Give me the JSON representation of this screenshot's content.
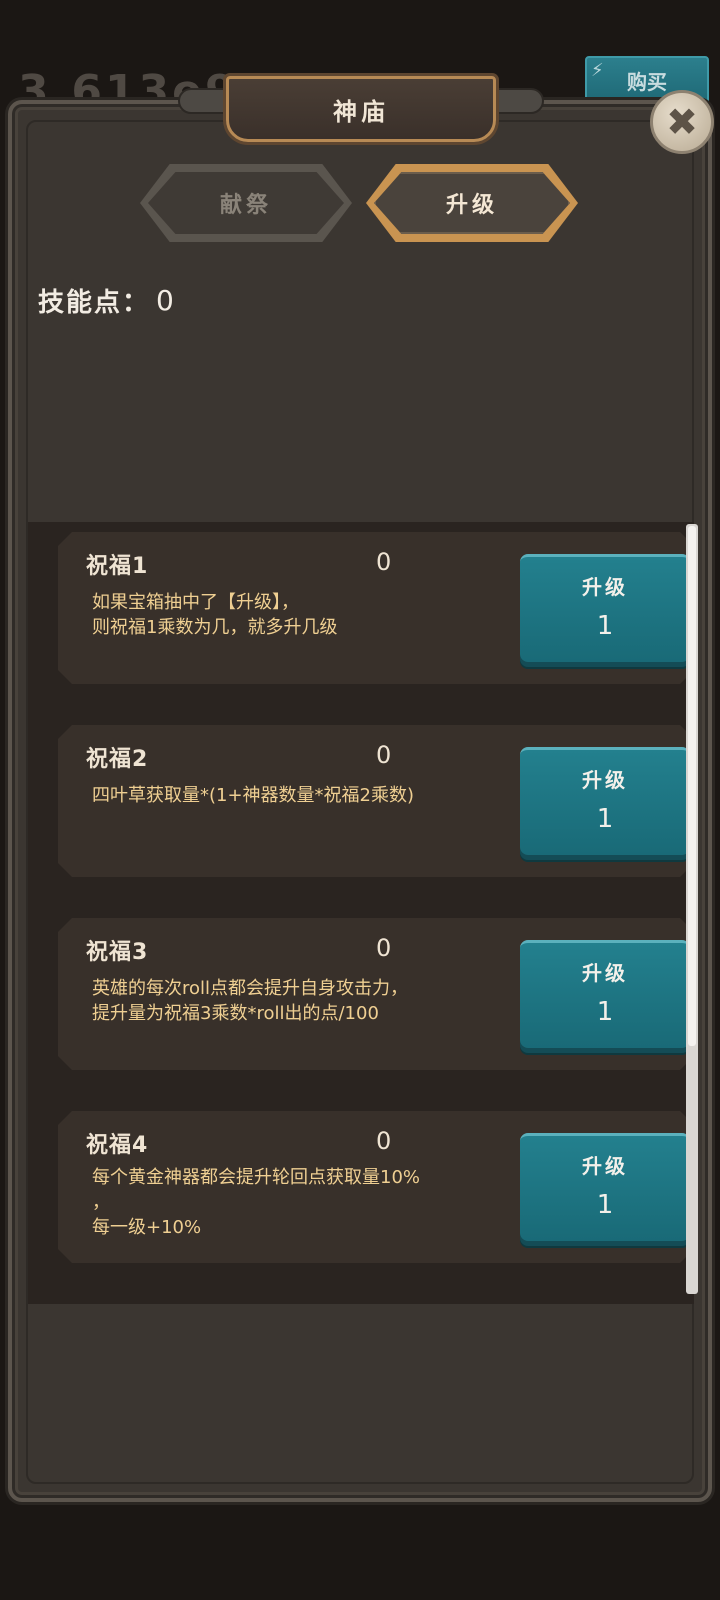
{
  "background": {
    "score_text": "3,613e9",
    "buy_label": "购买",
    "bolt_icon": "lightning-icon"
  },
  "dialog": {
    "title": "神庙",
    "close_icon": "close-icon",
    "tabs": [
      {
        "label": "献祭",
        "active": false
      },
      {
        "label": "升级",
        "active": true
      }
    ],
    "skill_points_label": "技能点：",
    "skill_points_value": "0"
  },
  "blessings": [
    {
      "name": "祝福1",
      "level": "0",
      "desc": "如果宝箱抽中了【升级】，\n则祝福1乘数为几，就多升几级",
      "button_label": "升级",
      "cost": "1"
    },
    {
      "name": "祝福2",
      "level": "0",
      "desc": "四叶草获取量*(1+神器数量*祝福2乘数)",
      "button_label": "升级",
      "cost": "1"
    },
    {
      "name": "祝福3",
      "level": "0",
      "desc": "英雄的每次roll点都会提升自身攻击力，\n提升量为祝福3乘数*roll出的点/100",
      "button_label": "升级",
      "cost": "1"
    },
    {
      "name": "祝福4",
      "level": "0",
      "desc": "每个黄金神器都会提升轮回点获取量10%\n，\n每一级+10%",
      "button_label": "升级",
      "cost": "1"
    }
  ],
  "colors": {
    "button_teal": "#1f7684",
    "desc_gold": "#efcf92",
    "tab_gold": "#c99451"
  }
}
